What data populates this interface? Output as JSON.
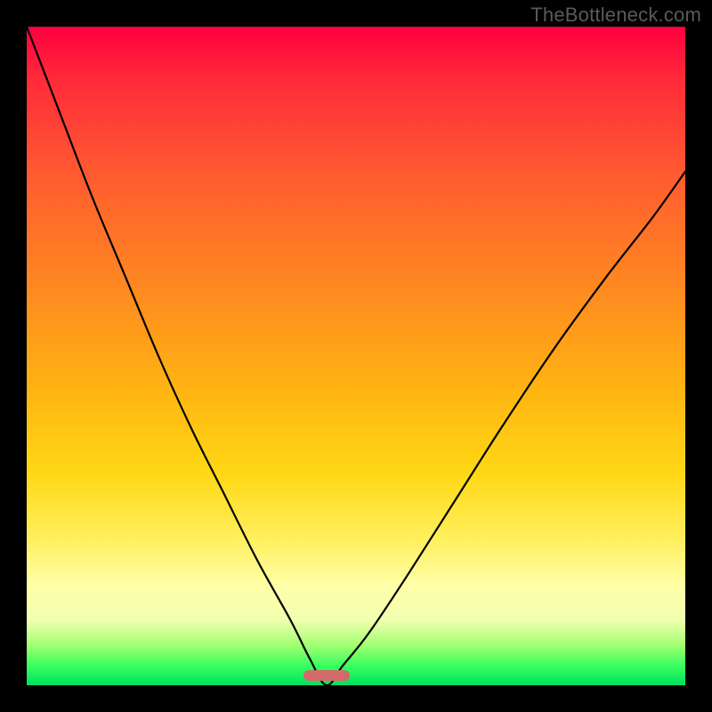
{
  "watermark": "TheBottleneck.com",
  "gradient_colors": {
    "top": "#ff0040",
    "mid": "#ffd815",
    "bottom": "#00e060"
  },
  "marker": {
    "color": "#d36a6a",
    "x_fraction_left": 0.42,
    "x_fraction_right": 0.49,
    "y_fraction": 0.985
  },
  "chart_data": {
    "type": "line",
    "title": "",
    "xlabel": "",
    "ylabel": "",
    "xlim": [
      0,
      1
    ],
    "ylim": [
      0,
      1
    ],
    "note": "V-shaped bottleneck curve; y≈0 near x≈0.45 and rises steeply toward both edges. Axis values are normalized positions read from pixel geometry since no tick labels are shown.",
    "series": [
      {
        "name": "bottleneck-curve",
        "x": [
          0.0,
          0.05,
          0.1,
          0.15,
          0.2,
          0.25,
          0.3,
          0.35,
          0.4,
          0.43,
          0.455,
          0.48,
          0.52,
          0.58,
          0.65,
          0.72,
          0.8,
          0.88,
          0.95,
          1.0
        ],
        "y": [
          1.0,
          0.87,
          0.74,
          0.62,
          0.5,
          0.39,
          0.29,
          0.19,
          0.1,
          0.04,
          0.0,
          0.03,
          0.08,
          0.17,
          0.28,
          0.39,
          0.51,
          0.62,
          0.71,
          0.78
        ]
      }
    ],
    "highlight_band_x": [
      0.42,
      0.49
    ]
  }
}
